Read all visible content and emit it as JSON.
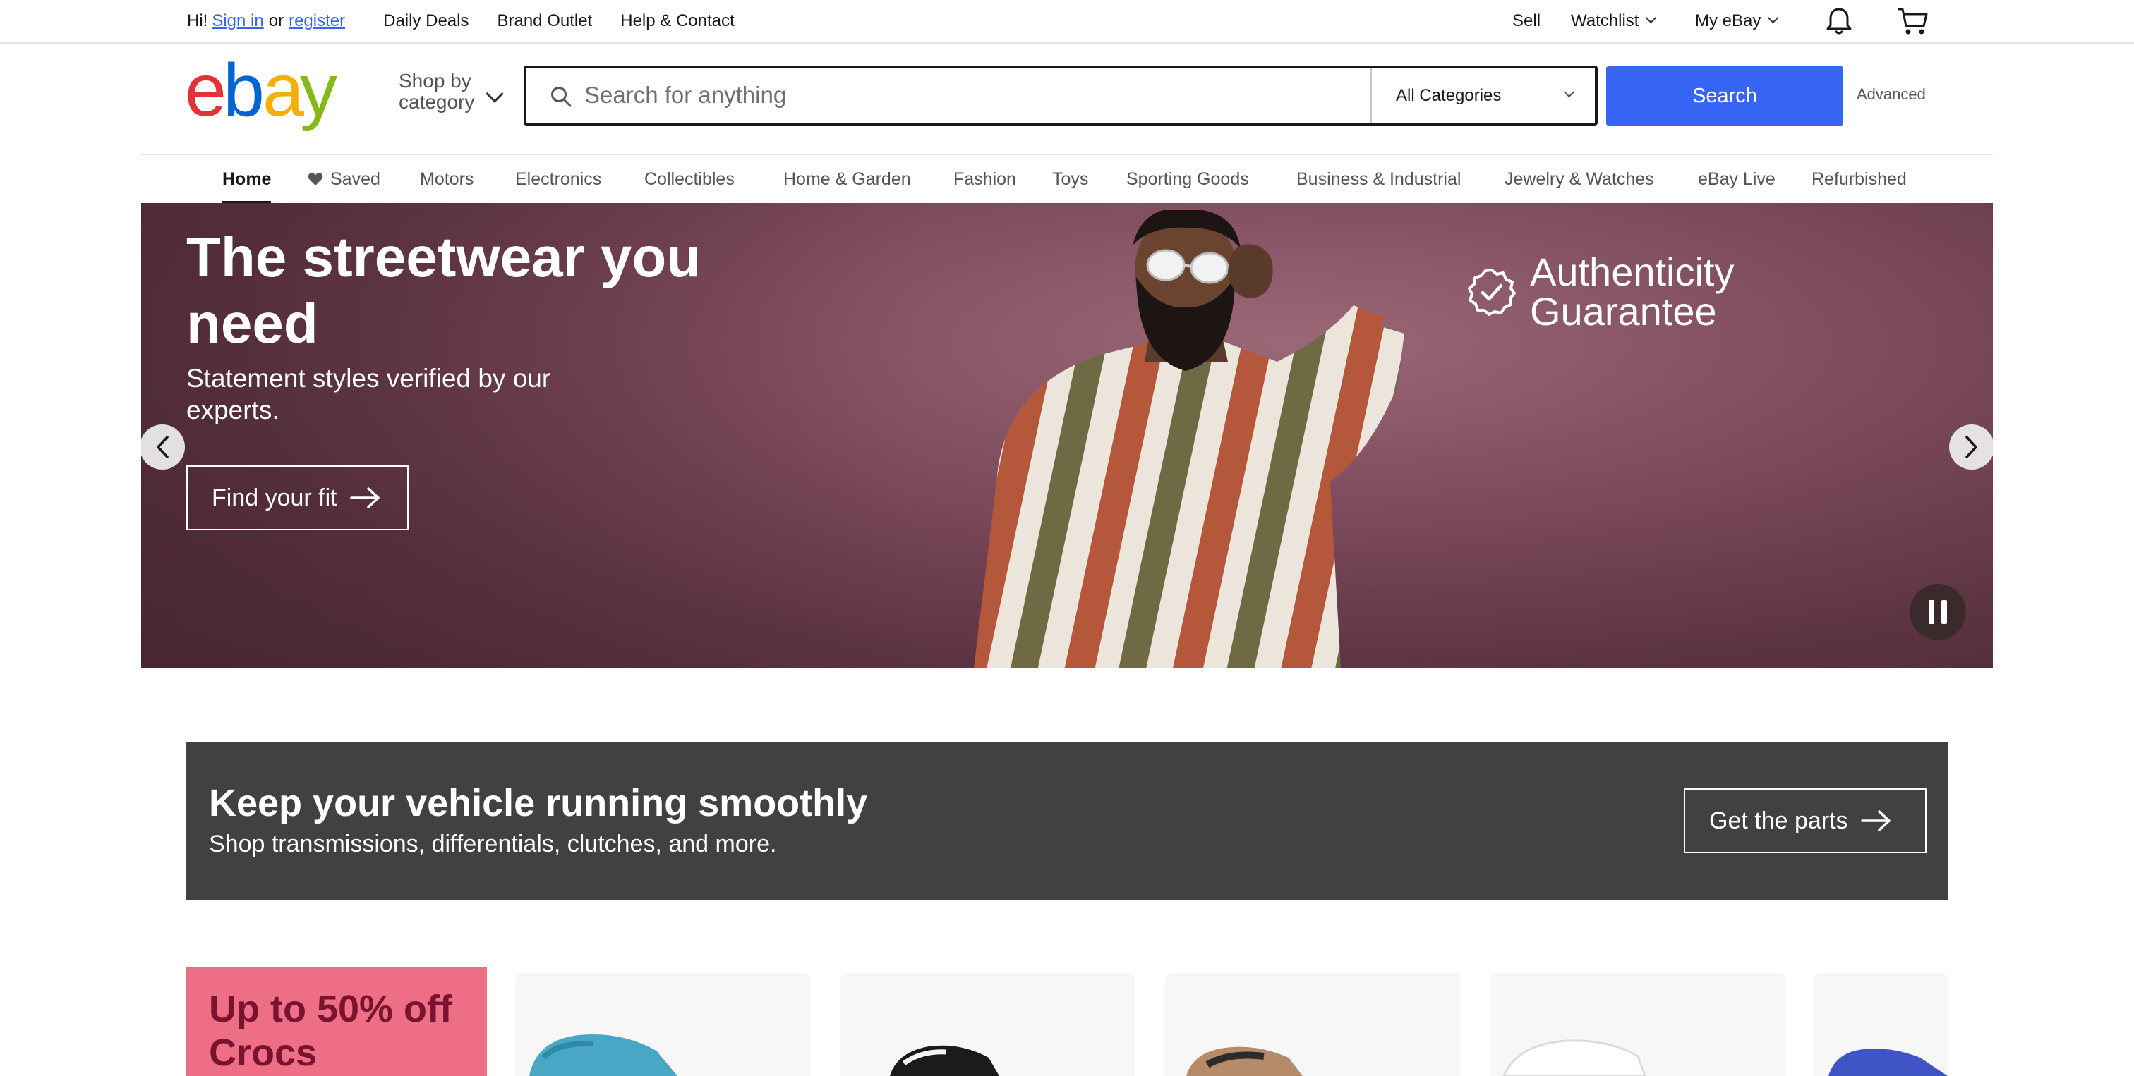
{
  "topbar": {
    "greeting": "Hi!",
    "signin_label": "Sign in",
    "or_text": "or",
    "register_label": "register",
    "daily_deals": "Daily Deals",
    "brand_outlet": "Brand Outlet",
    "help_contact": "Help & Contact",
    "sell": "Sell",
    "watchlist": "Watchlist",
    "my_ebay": "My eBay"
  },
  "header": {
    "shop_by_line1": "Shop by",
    "shop_by_line2": "category",
    "search_placeholder": "Search for anything",
    "category_selected": "All Categories",
    "search_button": "Search",
    "advanced": "Advanced"
  },
  "nav": {
    "items": [
      {
        "label": "Home"
      },
      {
        "label": "Saved"
      },
      {
        "label": "Motors"
      },
      {
        "label": "Electronics"
      },
      {
        "label": "Collectibles"
      },
      {
        "label": "Home & Garden"
      },
      {
        "label": "Fashion"
      },
      {
        "label": "Toys"
      },
      {
        "label": "Sporting Goods"
      },
      {
        "label": "Business & Industrial"
      },
      {
        "label": "Jewelry & Watches"
      },
      {
        "label": "eBay Live"
      },
      {
        "label": "Refurbished"
      }
    ]
  },
  "hero": {
    "title": "The streetwear you need",
    "subtitle": "Statement styles verified by our experts.",
    "cta": "Find your fit",
    "badge_line1": "Authenticity",
    "badge_line2": "Guarantee"
  },
  "promo": {
    "title": "Keep your vehicle running smoothly",
    "subtitle": "Shop transmissions, differentials, clutches, and more.",
    "cta": "Get the parts"
  },
  "crocs": {
    "title": "Up to 50% off Crocs"
  },
  "colors": {
    "brand_blue": "#3665f3",
    "logo_red": "#e53238",
    "logo_blue": "#0064d2",
    "logo_yellow": "#f5af02",
    "logo_green": "#86b817",
    "promo_bg": "#414141",
    "crocs_bg": "#ee6e85",
    "crocs_text": "#7a1330"
  },
  "icons": [
    "search-icon",
    "chevron-down-icon",
    "bell-icon",
    "cart-icon",
    "heart-icon",
    "arrow-right-icon",
    "chevron-left-icon",
    "chevron-right-icon",
    "pause-icon",
    "check-badge-icon"
  ]
}
